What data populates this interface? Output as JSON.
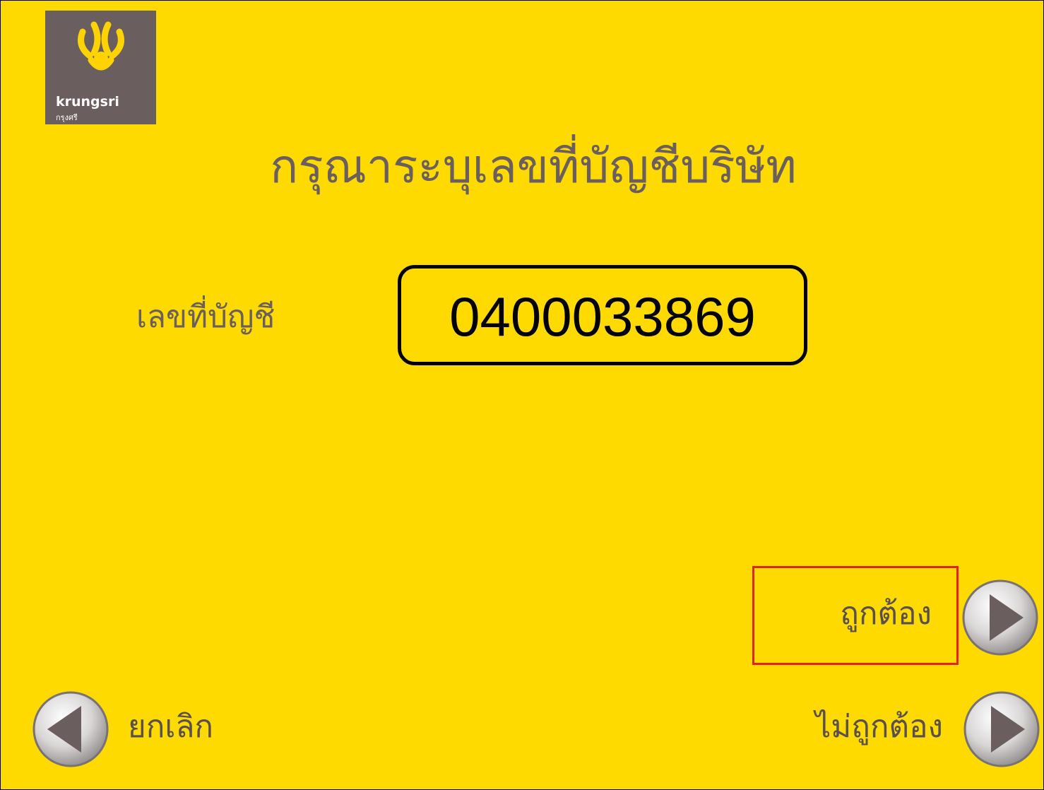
{
  "brand": {
    "name": "krungsri",
    "name_thai": "กรุงศรี",
    "colors": {
      "background": "#FFDA00",
      "brand_gray": "#6A5E5E",
      "highlight": "#E8201E"
    }
  },
  "screen": {
    "title": "กรุณาระบุเลขที่บัญชีบริษัท",
    "account": {
      "label": "เลขที่บัญชี",
      "value": "0400033869"
    }
  },
  "options": {
    "correct": {
      "label": "ถูกต้อง",
      "icon": "right-arrow-icon"
    },
    "incorrect": {
      "label": "ไม่ถูกต้อง",
      "icon": "right-arrow-icon"
    },
    "cancel": {
      "label": "ยกเลิก",
      "icon": "left-arrow-icon"
    }
  }
}
